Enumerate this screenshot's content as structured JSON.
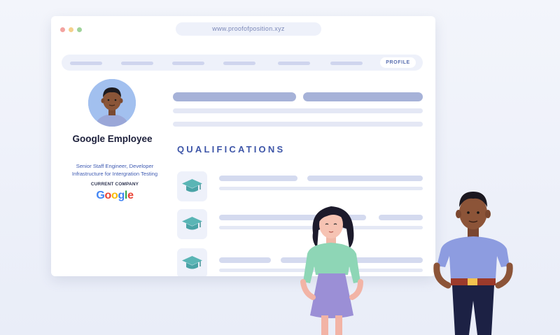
{
  "browser": {
    "url": "www.proofofposition.xyz",
    "traffic_light_colors": [
      "#f3a3a0",
      "#f4d08c",
      "#9fd39a"
    ]
  },
  "nav": {
    "active_tab": "PROFILE"
  },
  "profile": {
    "name": "Google Employee",
    "role_line1": "Senior Staff Engineer, Developer",
    "role_line2": "Infrastructure for Intergration Testing",
    "current_company_label": "CURRENT COMPANY",
    "company_logo_text": "Google"
  },
  "section": {
    "title": "QUALIFICATIONS"
  },
  "qualifications": [
    {
      "icon": "graduation-cap-icon"
    },
    {
      "icon": "graduation-cap-icon"
    },
    {
      "icon": "graduation-cap-icon"
    }
  ],
  "colors": {
    "accent": "#3e56a8",
    "cap_teal": "#5ab5b5",
    "google_blue": "#4285f4",
    "google_red": "#ea4335",
    "google_yellow": "#fbbc05",
    "google_green": "#34a853"
  }
}
